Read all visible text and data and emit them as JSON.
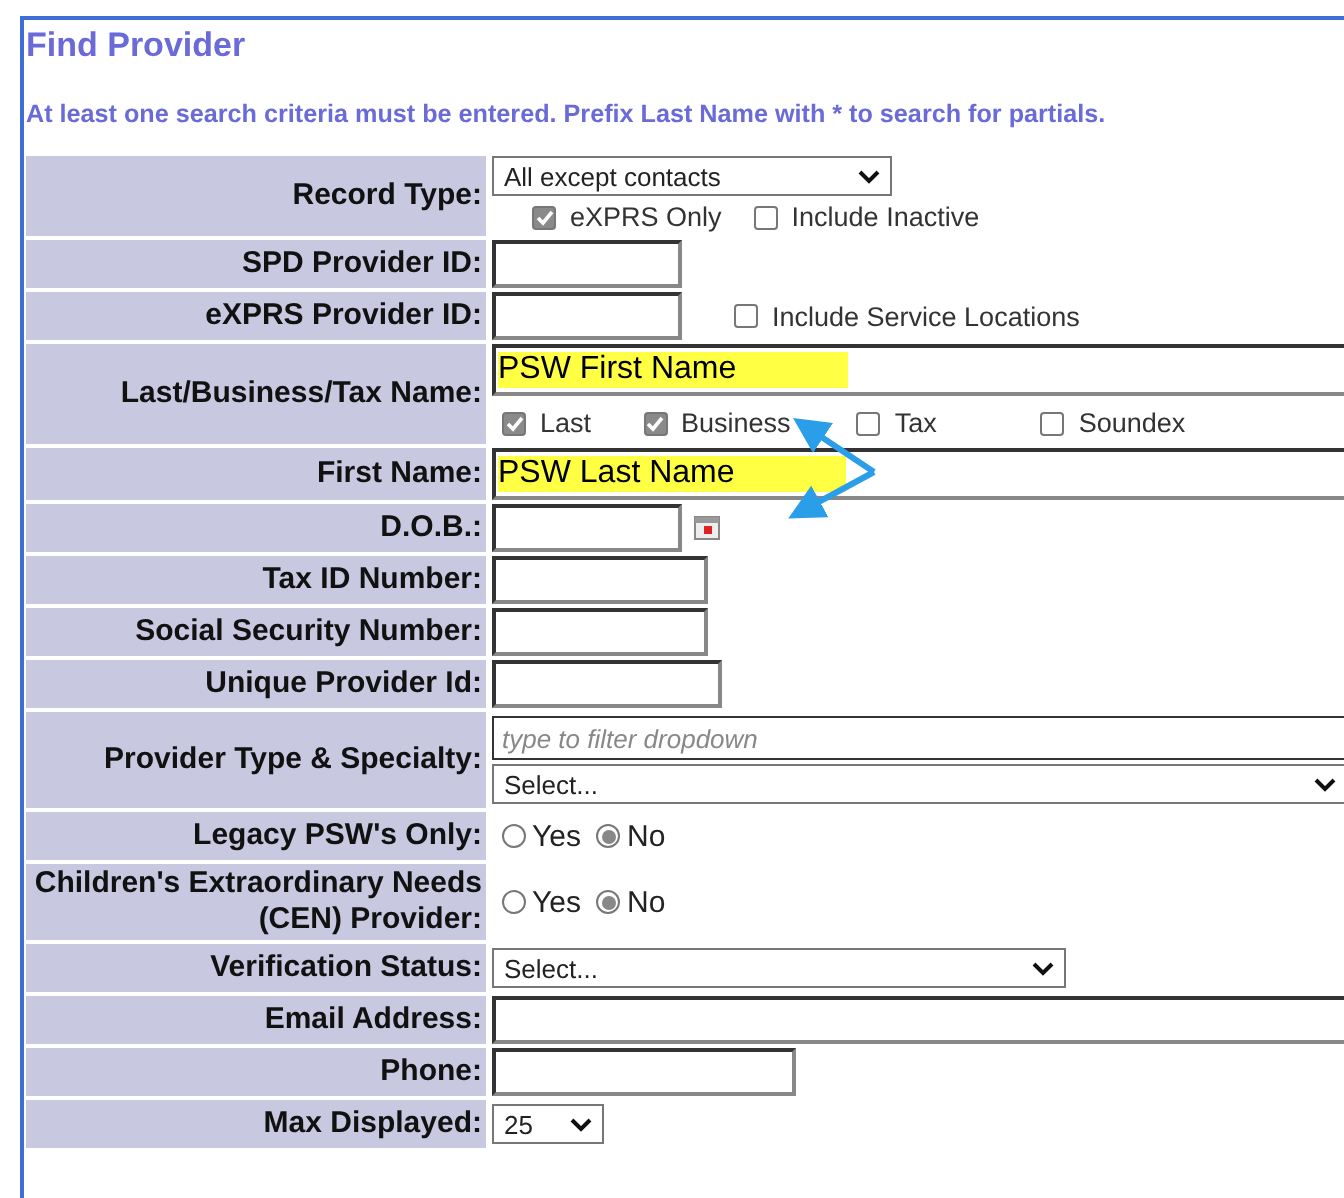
{
  "title": "Find Provider",
  "instructions": "At least one search criteria must be entered. Prefix Last Name with * to search for partials.",
  "rows": [
    {
      "label": "Record Type:",
      "kind": "select",
      "value": "All except contacts",
      "checks": [
        {
          "label": "eXPRS Only",
          "checked": true
        },
        {
          "label": "Include Inactive",
          "checked": false
        }
      ]
    },
    {
      "label": "SPD Provider ID:",
      "kind": "text"
    },
    {
      "label": "eXPRS Provider ID:",
      "kind": "text",
      "side_checks": [
        {
          "label": "Include Service Locations",
          "checked": false
        }
      ]
    },
    {
      "label": "Last/Business/Tax Name:",
      "kind": "text",
      "value": "PSW First Name",
      "highlighted": true,
      "checks": [
        {
          "label": "Last",
          "checked": true
        },
        {
          "label": "Business",
          "checked": true
        },
        {
          "label": "Tax",
          "checked": false
        },
        {
          "label": "Soundex",
          "checked": false
        }
      ]
    },
    {
      "label": "First Name:",
      "kind": "text",
      "value": "PSW Last Name",
      "highlighted": true
    },
    {
      "label": "D.O.B.:",
      "kind": "date"
    },
    {
      "label": "Tax ID Number:",
      "kind": "text"
    },
    {
      "label": "Social Security Number:",
      "kind": "text"
    },
    {
      "label": "Unique Provider Id:",
      "kind": "text"
    },
    {
      "label": "Provider Type & Specialty:",
      "kind": "filter_select",
      "placeholder": "type to filter dropdown",
      "value": "Select..."
    },
    {
      "label": "Legacy PSW's Only:",
      "kind": "radio",
      "options": [
        {
          "label": "Yes",
          "selected": false
        },
        {
          "label": "No",
          "selected": true
        }
      ]
    },
    {
      "label": "Children's Extraordinary Needs (CEN) Provider:",
      "kind": "radio",
      "options": [
        {
          "label": "Yes",
          "selected": false
        },
        {
          "label": "No",
          "selected": true
        }
      ]
    },
    {
      "label": "Verification Status:",
      "kind": "select",
      "value": "Select..."
    },
    {
      "label": "Email Address:",
      "kind": "text"
    },
    {
      "label": "Phone:",
      "kind": "text"
    },
    {
      "label": "Max Displayed:",
      "kind": "select",
      "value": "25"
    }
  ],
  "annotation": {
    "kind": "double_arrow"
  }
}
